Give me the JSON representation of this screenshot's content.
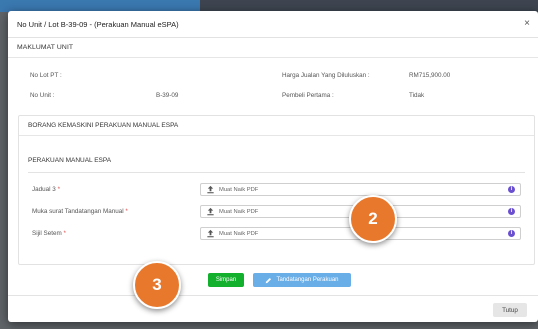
{
  "modal": {
    "title": "No Unit / Lot B-39-09 - (Perakuan Manual eSPA)",
    "close_symbol": "×"
  },
  "maklumat": {
    "heading": "MAKLUMAT UNIT",
    "lot_pt_label": "No Lot PT :",
    "lot_pt_value": "",
    "unit_label": "No Unit :",
    "unit_value": "B-39-09",
    "harga_label": "Harga Jualan Yang Diluluskan :",
    "harga_value": "RM715,900.00",
    "pembeli_label": "Pembeli Pertama :",
    "pembeli_value": "Tidak"
  },
  "borang": {
    "heading": "BORANG KEMASKINI PERAKUAN MANUAL ESPA",
    "subheading": "PERAKUAN MANUAL ESPA",
    "required_mark": "*",
    "fields": [
      {
        "label": "Jadual 3",
        "placeholder": "Muat Naik PDF"
      },
      {
        "label": "Muka surat Tandatangan Manual",
        "placeholder": "Muat Naik PDF"
      },
      {
        "label": "Sijil Setem",
        "placeholder": "Muat Naik PDF"
      }
    ]
  },
  "buttons": {
    "simpan": "Simpan",
    "tandatangan": "Tandatangan Perakuan",
    "tutup": "Tutup"
  },
  "annotations": [
    "2",
    "3"
  ],
  "icons": [
    "close-icon",
    "upload-icon",
    "info-icon",
    "pencil-icon"
  ],
  "colors": {
    "simpan": "#13b02d",
    "tandatangan": "#6aaee8",
    "badge": "#e8782b",
    "info": "#6a4fd1"
  }
}
